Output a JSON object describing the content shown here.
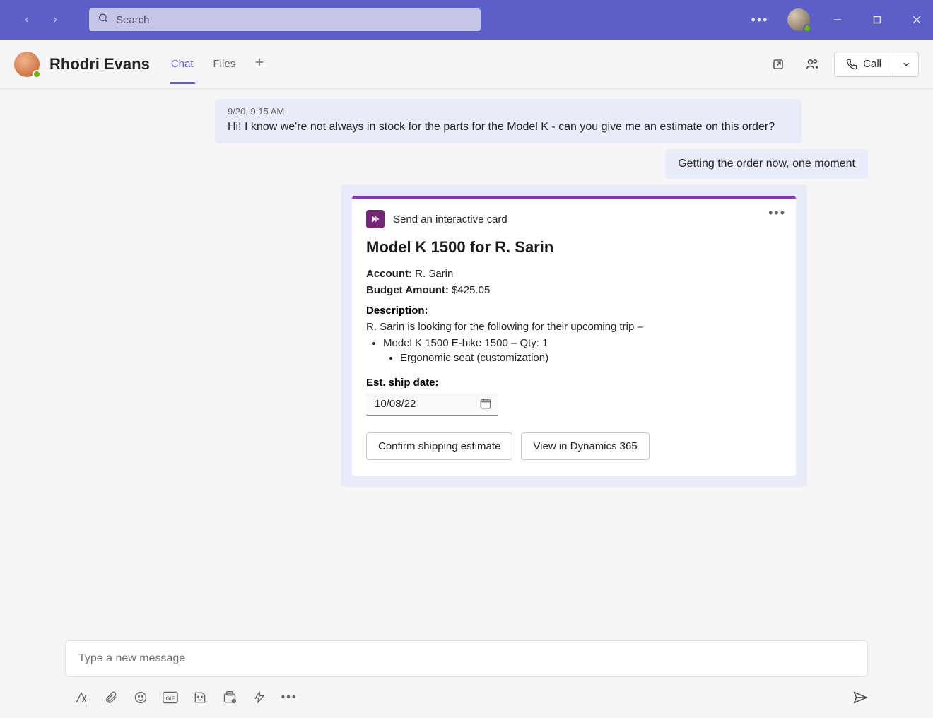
{
  "titlebar": {
    "search_placeholder": "Search"
  },
  "chat_header": {
    "peer_name": "Rhodri Evans",
    "tabs": [
      {
        "label": "Chat",
        "active": true
      },
      {
        "label": "Files",
        "active": false
      }
    ],
    "call_label": "Call"
  },
  "messages": {
    "m1_time": "9/20, 9:15 AM",
    "m1_text": "Hi! I know we're not always in stock for the parts for the Model K - can you give me an estimate on this order?",
    "m2_text": "Getting the order now, one moment"
  },
  "card": {
    "sender_app": "Send an interactive card",
    "title": "Model K 1500 for R. Sarin",
    "account_label": "Account:",
    "account_value": "R. Sarin",
    "budget_label": "Budget Amount:",
    "budget_value": "$425.05",
    "description_label": "Description:",
    "description_text": "R. Sarin is looking for the following for their upcoming trip –",
    "line_item_1": "Model K 1500 E-bike 1500 – Qty: 1",
    "line_item_1a": "Ergonomic seat (customization)",
    "ship_label": "Est. ship date:",
    "ship_value": "10/08/22",
    "btn_confirm": "Confirm shipping estimate",
    "btn_view": "View in Dynamics 365"
  },
  "composer": {
    "placeholder": "Type a new message"
  }
}
